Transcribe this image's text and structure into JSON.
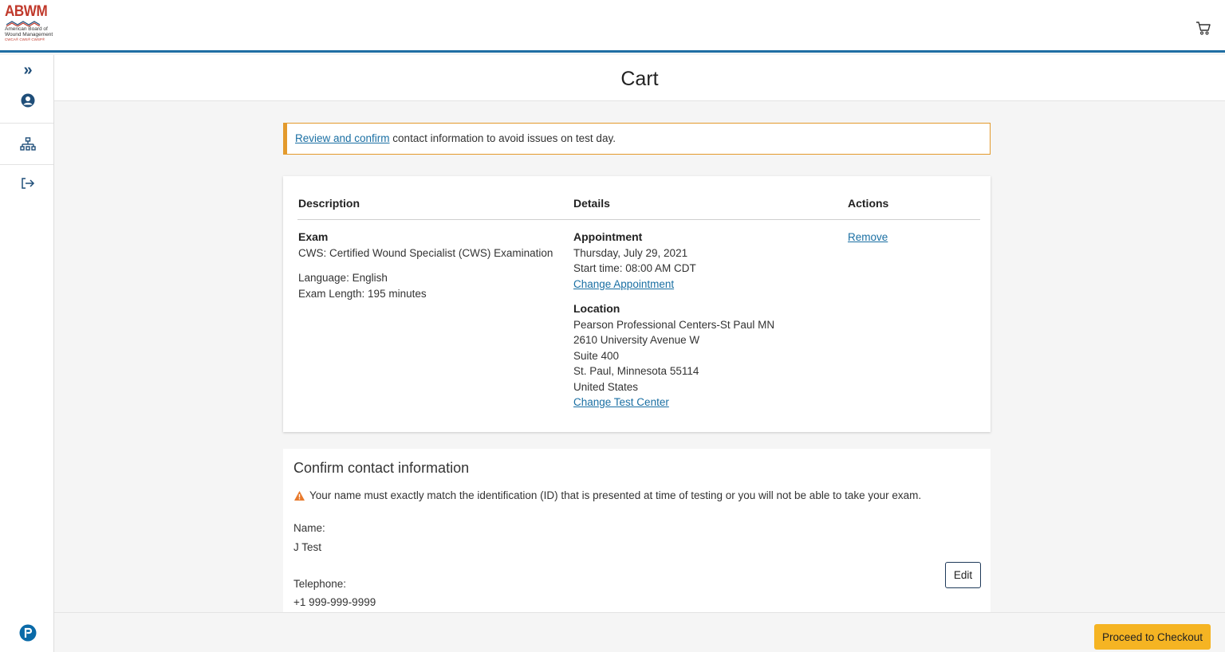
{
  "header": {
    "logo": {
      "abbr": "ABWM",
      "line1": "American Board of",
      "line2": "Wound Management",
      "line3": "CWCA® CWS® CWSP®"
    },
    "cart_icon": "cart-icon"
  },
  "sidebar": {
    "items": [
      {
        "icon": "expand-icon",
        "glyph": "»"
      },
      {
        "icon": "user-icon"
      },
      {
        "icon": "sitemap-icon"
      },
      {
        "icon": "logout-icon"
      }
    ],
    "bottom_icon": "pearson-icon"
  },
  "page": {
    "title": "Cart"
  },
  "alert": {
    "link": "Review and confirm",
    "text": " contact information to avoid issues on test day.",
    "color": "#e39a2c"
  },
  "table": {
    "headers": {
      "description": "Description",
      "details": "Details",
      "actions": "Actions"
    },
    "row": {
      "type": "Exam",
      "exam_name": "CWS: Certified Wound Specialist (CWS) Examination",
      "language": "Language: English",
      "length": "Exam Length: 195 minutes",
      "appointment_label": "Appointment",
      "appointment_date": "Thursday, July 29, 2021",
      "start_time": "Start time: 08:00 AM CDT",
      "change_appointment": "Change Appointment",
      "location_label": "Location",
      "location_lines": [
        "Pearson Professional Centers-St Paul MN",
        "2610 University Avenue W",
        "Suite 400",
        "St. Paul, Minnesota 55114",
        "United States"
      ],
      "change_center": "Change Test Center",
      "remove": "Remove"
    }
  },
  "contact": {
    "title": "Confirm contact information",
    "warning": "Your name must exactly match the identification (ID) that is presented at time of testing or you will not be able to take your exam.",
    "name_label": "Name:",
    "name_value": "J Test",
    "phone_label": "Telephone:",
    "phone_value": "+1 999-999-9999",
    "edit": "Edit"
  },
  "footer": {
    "checkout": "Proceed to Checkout"
  },
  "colors": {
    "accent_blue": "#1f6ea4",
    "link": "#1a6fa3",
    "checkout": "#f5b423",
    "warning": "#e39a2c"
  }
}
